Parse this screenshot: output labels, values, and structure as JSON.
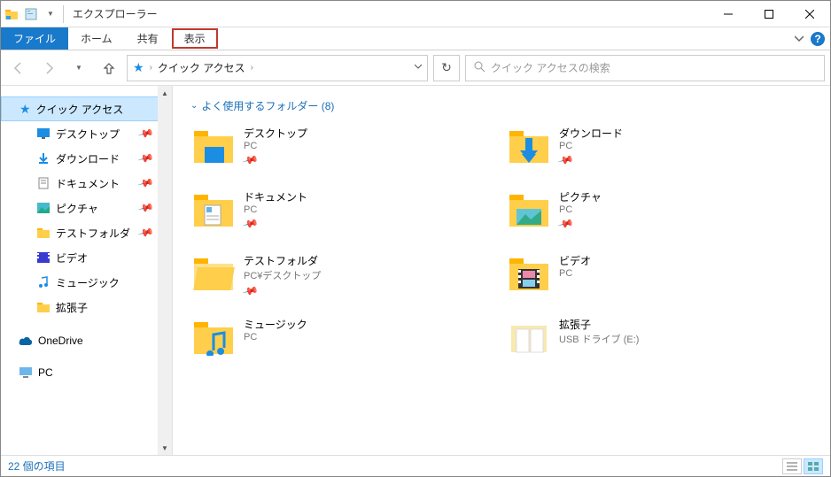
{
  "window": {
    "title": "エクスプローラー"
  },
  "ribbon": {
    "file": "ファイル",
    "home": "ホーム",
    "share": "共有",
    "view": "表示"
  },
  "breadcrumb": {
    "root": "クイック アクセス"
  },
  "search": {
    "placeholder": "クイック アクセスの検索"
  },
  "sidebar": {
    "quick_access": "クイック アクセス",
    "items": [
      {
        "label": "デスクトップ",
        "pin": true
      },
      {
        "label": "ダウンロード",
        "pin": true
      },
      {
        "label": "ドキュメント",
        "pin": true
      },
      {
        "label": "ピクチャ",
        "pin": true
      },
      {
        "label": "テストフォルダ",
        "pin": true
      },
      {
        "label": "ビデオ",
        "pin": false
      },
      {
        "label": "ミュージック",
        "pin": false
      },
      {
        "label": "拡張子",
        "pin": false
      }
    ],
    "onedrive": "OneDrive",
    "pc": "PC"
  },
  "section": {
    "title": "よく使用するフォルダー (8)"
  },
  "folders": [
    {
      "name": "デスクトップ",
      "sub": "PC",
      "pin": true
    },
    {
      "name": "ダウンロード",
      "sub": "PC",
      "pin": true
    },
    {
      "name": "ドキュメント",
      "sub": "PC",
      "pin": true
    },
    {
      "name": "ピクチャ",
      "sub": "PC",
      "pin": true
    },
    {
      "name": "テストフォルダ",
      "sub": "PC¥デスクトップ",
      "pin": true
    },
    {
      "name": "ビデオ",
      "sub": "PC",
      "pin": false
    },
    {
      "name": "ミュージック",
      "sub": "PC",
      "pin": false
    },
    {
      "name": "拡張子",
      "sub": "USB ドライブ (E:)",
      "pin": false
    }
  ],
  "status": {
    "text": "22 個の項目"
  }
}
